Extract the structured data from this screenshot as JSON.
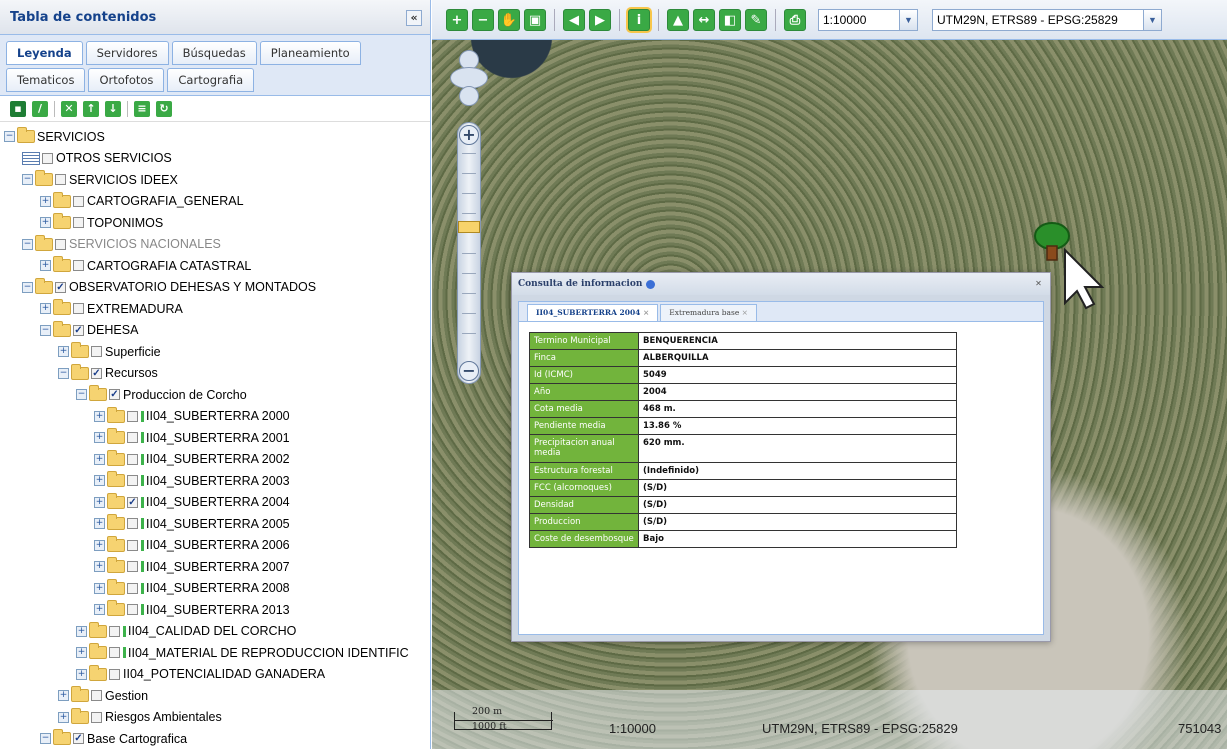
{
  "toc": {
    "title": "Tabla de contenidos",
    "collapse_icon": "«"
  },
  "tabs": {
    "row1": [
      "Leyenda",
      "Servidores",
      "Búsquedas",
      "Planeamiento"
    ],
    "row2": [
      "Tematicos",
      "Ortofotos",
      "Cartografia"
    ],
    "active": "Leyenda"
  },
  "tree": [
    {
      "label": "SERVICIOS",
      "level": 0,
      "pm": "-",
      "cb": null,
      "legend": false
    },
    {
      "label": "OTROS SERVICIOS",
      "level": 1,
      "pm": null,
      "list": true,
      "cb": false,
      "legend": false
    },
    {
      "label": "SERVICIOS IDEEX",
      "level": 1,
      "pm": "-",
      "cb": false,
      "legend": false
    },
    {
      "label": "CARTOGRAFIA_GENERAL",
      "level": 2,
      "pm": "+",
      "cb": false,
      "legend": false
    },
    {
      "label": "TOPONIMOS",
      "level": 2,
      "pm": "+",
      "cb": false,
      "legend": false
    },
    {
      "label": "SERVICIOS NACIONALES",
      "level": 1,
      "pm": "-",
      "cb": false,
      "legend": false,
      "dim": true
    },
    {
      "label": " CARTOGRAFIA CATASTRAL",
      "level": 2,
      "pm": "+",
      "cb": false,
      "legend": false
    },
    {
      "label": "OBSERVATORIO DEHESAS Y MONTADOS",
      "level": 1,
      "pm": "-",
      "cb": true,
      "legend": false
    },
    {
      "label": "EXTREMADURA",
      "level": 2,
      "pm": "+",
      "cb": false,
      "legend": false
    },
    {
      "label": "DEHESA",
      "level": 2,
      "pm": "-",
      "cb": true,
      "legend": false
    },
    {
      "label": "Superficie",
      "level": 3,
      "pm": "+",
      "cb": false,
      "legend": false
    },
    {
      "label": "Recursos",
      "level": 3,
      "pm": "-",
      "cb": true,
      "legend": false
    },
    {
      "label": "Produccion de Corcho",
      "level": 4,
      "pm": "-",
      "cb": true,
      "legend": false
    },
    {
      "label": "II04_SUBERTERRA 2000",
      "level": 5,
      "pm": "+",
      "cb": false,
      "legend": true
    },
    {
      "label": "II04_SUBERTERRA 2001",
      "level": 5,
      "pm": "+",
      "cb": false,
      "legend": true
    },
    {
      "label": "II04_SUBERTERRA 2002",
      "level": 5,
      "pm": "+",
      "cb": false,
      "legend": true
    },
    {
      "label": "II04_SUBERTERRA 2003",
      "level": 5,
      "pm": "+",
      "cb": false,
      "legend": true
    },
    {
      "label": "II04_SUBERTERRA 2004",
      "level": 5,
      "pm": "+",
      "cb": true,
      "legend": true
    },
    {
      "label": "II04_SUBERTERRA 2005",
      "level": 5,
      "pm": "+",
      "cb": false,
      "legend": true
    },
    {
      "label": "II04_SUBERTERRA 2006",
      "level": 5,
      "pm": "+",
      "cb": false,
      "legend": true
    },
    {
      "label": "II04_SUBERTERRA 2007",
      "level": 5,
      "pm": "+",
      "cb": false,
      "legend": true
    },
    {
      "label": "II04_SUBERTERRA 2008",
      "level": 5,
      "pm": "+",
      "cb": false,
      "legend": true
    },
    {
      "label": "II04_SUBERTERRA 2013",
      "level": 5,
      "pm": "+",
      "cb": false,
      "legend": true
    },
    {
      "label": "II04_CALIDAD DEL CORCHO",
      "level": 4,
      "pm": "+",
      "cb": false,
      "legend": true
    },
    {
      "label": "II04_MATERIAL DE REPRODUCCION IDENTIFIC",
      "level": 4,
      "pm": "+",
      "cb": false,
      "legend": true
    },
    {
      "label": "II04_POTENCIALIDAD GANADERA",
      "level": 4,
      "pm": "+",
      "cb": false,
      "legend": false
    },
    {
      "label": "Gestion",
      "level": 3,
      "pm": "+",
      "cb": false,
      "legend": false
    },
    {
      "label": "Riesgos Ambientales",
      "level": 3,
      "pm": "+",
      "cb": false,
      "legend": false
    },
    {
      "label": "Base Cartografica",
      "level": 2,
      "pm": "-",
      "cb": true,
      "legend": false
    }
  ],
  "map_toolbar": {
    "scale_select": "1:10000",
    "projection_select": "UTM29N, ETRS89 - EPSG:25829"
  },
  "popup": {
    "title": "Consulta de informacion",
    "tabs": [
      "II04_SUBERTERRA 2004",
      "Extremadura base"
    ],
    "rows": [
      {
        "k": "Termino Municipal",
        "v": "BENQUERENCIA"
      },
      {
        "k": "Finca",
        "v": "ALBERQUILLA"
      },
      {
        "k": "Id (ICMC)",
        "v": "5049"
      },
      {
        "k": "Año",
        "v": "2004"
      },
      {
        "k": "Cota media",
        "v": "468 m."
      },
      {
        "k": "Pendiente media",
        "v": "13.86 %"
      },
      {
        "k": "Precipitacion anual media",
        "v": "620 mm."
      },
      {
        "k": "Estructura forestal",
        "v": "(Indefinido)"
      },
      {
        "k": "FCC (alcornoques)",
        "v": "(S/D)"
      },
      {
        "k": "Densidad",
        "v": "(S/D)"
      },
      {
        "k": "Produccion",
        "v": "(S/D)"
      },
      {
        "k": "Coste de desembosque",
        "v": "Bajo"
      }
    ]
  },
  "status": {
    "scale_m": "200 m",
    "scale_ft": "1000 ft",
    "scale": "1:10000",
    "projection": "UTM29N, ETRS89 - EPSG:25829",
    "coord": "751043"
  },
  "colors": {
    "toolbar_green": "#3aa945",
    "popup_key_bg": "#72b43c",
    "header_text": "#15428b"
  }
}
